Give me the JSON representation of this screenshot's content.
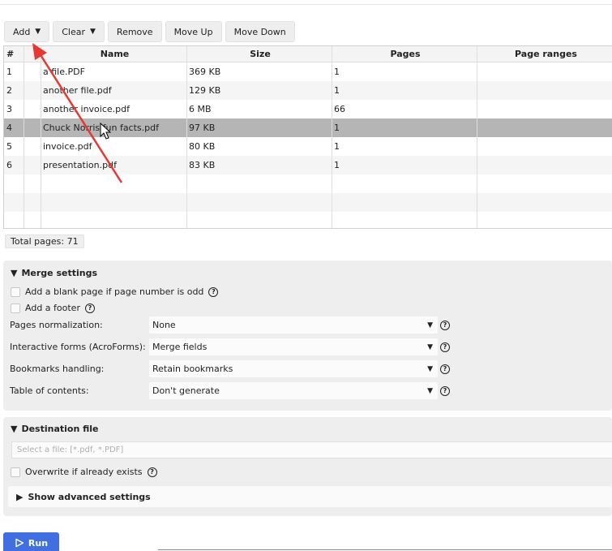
{
  "toolbar": {
    "add_label": "Add",
    "clear_label": "Clear",
    "remove_label": "Remove",
    "move_up_label": "Move Up",
    "move_down_label": "Move Down"
  },
  "table": {
    "headers": [
      "#",
      "Name",
      "Size",
      "Pages",
      "Page ranges"
    ],
    "rows": [
      {
        "num": "1",
        "name": "a file.PDF",
        "size": "369 KB",
        "pages": "1",
        "ranges": ""
      },
      {
        "num": "2",
        "name": "another file.pdf",
        "size": "129 KB",
        "pages": "1",
        "ranges": ""
      },
      {
        "num": "3",
        "name": "another invoice.pdf",
        "size": "6 MB",
        "pages": "66",
        "ranges": ""
      },
      {
        "num": "4",
        "name": "Chuck Norris fun facts.pdf",
        "size": "97 KB",
        "pages": "1",
        "ranges": ""
      },
      {
        "num": "5",
        "name": "invoice.pdf",
        "size": "80 KB",
        "pages": "1",
        "ranges": ""
      },
      {
        "num": "6",
        "name": "presentation.pdf",
        "size": "83 KB",
        "pages": "1",
        "ranges": ""
      }
    ],
    "selected_row": "4"
  },
  "total_pages": "Total pages: 71",
  "merge": {
    "title": "Merge settings",
    "blank_page_label": "Add a blank page if page number is odd",
    "footer_label": "Add a footer",
    "normalization_label": "Pages normalization:",
    "normalization_value": "None",
    "forms_label": "Interactive forms (AcroForms):",
    "forms_value": "Merge fields",
    "bookmarks_label": "Bookmarks handling:",
    "bookmarks_value": "Retain bookmarks",
    "toc_label": "Table of contents:",
    "toc_value": "Don't generate"
  },
  "destination": {
    "title": "Destination file",
    "placeholder": "Select a file: [*.pdf, *.PDF]",
    "overwrite_label": "Overwrite if already exists",
    "advanced_label": "Show advanced settings"
  },
  "run_label": "Run",
  "help_glyph": "?",
  "colors": {
    "accent": "#3f6fe0",
    "selected_row": "#b5b5b5",
    "annotation_arrow": "#e53935"
  }
}
